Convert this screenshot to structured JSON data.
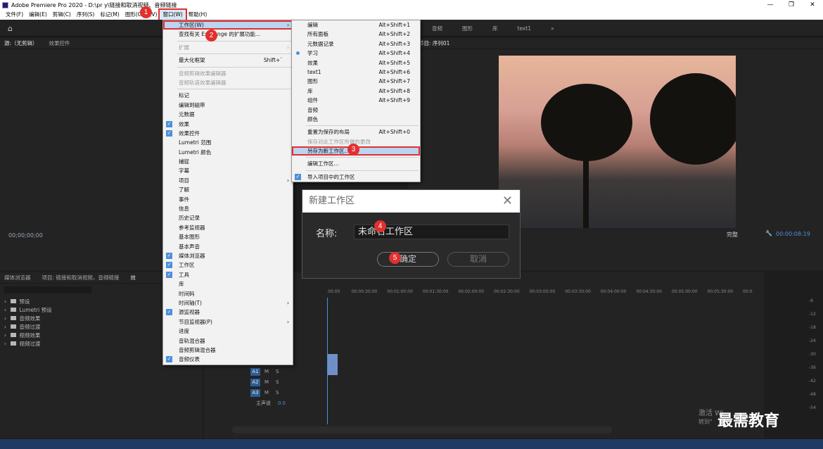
{
  "window": {
    "title": "Adobe Premiere Pro 2020 - D:\\pr y\\链接和取消视频、音频链接",
    "controls": [
      "—",
      "❐",
      "✕"
    ]
  },
  "menubar": [
    "文件(F)",
    "编辑(E)",
    "剪辑(C)",
    "序列(S)",
    "标记(M)",
    "图形(G)",
    "(V)",
    "窗口(W)",
    "帮助(H)"
  ],
  "workspace_tabs": [
    "音频",
    "图形",
    "库",
    "text1",
    "»"
  ],
  "source_panel": {
    "tabs": [
      "源:（无剪辑）",
      "效果控件"
    ],
    "timecode": "00;00;00;00"
  },
  "program_panel": {
    "title": "节目: 序列01",
    "fit": "完整",
    "timecode": "00:00:08:19"
  },
  "project_panel": {
    "tabs": [
      "媒体浏览器",
      "项目: 链接和取消视频，音频链接",
      "效"
    ],
    "tree": [
      "预设",
      "Lumetri 预设",
      "音频效果",
      "音频过渡",
      "视频效果",
      "视频过渡"
    ]
  },
  "window_menu": {
    "items": [
      {
        "label": "工作区(W)",
        "sub": true,
        "hl": true
      },
      {
        "label": "查找有关 Exchange 的扩展功能..."
      },
      {
        "sep": true
      },
      {
        "label": "扩展",
        "sub": true,
        "disabled": true
      },
      {
        "sep": true
      },
      {
        "label": "最大化框架",
        "shortcut": "Shift+`"
      },
      {
        "sep": true
      },
      {
        "label": "音频剪辑效果编辑器",
        "disabled": true
      },
      {
        "label": "音频轨道效果编辑器",
        "disabled": true
      },
      {
        "sep": true
      },
      {
        "label": "标记"
      },
      {
        "label": "编辑到磁带"
      },
      {
        "label": "元数据"
      },
      {
        "label": "效果",
        "checked": true
      },
      {
        "label": "效果控件",
        "checked": true
      },
      {
        "label": "Lumetri 范围"
      },
      {
        "label": "Lumetri 颜色"
      },
      {
        "label": "捕捉"
      },
      {
        "label": "字幕"
      },
      {
        "label": "项目",
        "sub": true
      },
      {
        "label": "了解"
      },
      {
        "label": "事件"
      },
      {
        "label": "信息"
      },
      {
        "label": "历史记录"
      },
      {
        "label": "参考监视器"
      },
      {
        "label": "基本图形"
      },
      {
        "label": "基本声音"
      },
      {
        "label": "媒体浏览器",
        "checked": true
      },
      {
        "label": "工作区",
        "checked": true
      },
      {
        "label": "工具",
        "checked": true
      },
      {
        "label": "库"
      },
      {
        "label": "时间码"
      },
      {
        "label": "时间轴(T)",
        "sub": true
      },
      {
        "label": "源监视器",
        "checked": true
      },
      {
        "label": "节目监视器(P)",
        "sub": true
      },
      {
        "label": "进度"
      },
      {
        "label": "音轨混合器"
      },
      {
        "label": "音频剪辑混合器"
      },
      {
        "label": "音频仪表",
        "checked": true
      }
    ]
  },
  "workspace_submenu": {
    "items": [
      {
        "label": "编辑",
        "shortcut": "Alt+Shift+1"
      },
      {
        "label": "所有面板",
        "shortcut": "Alt+Shift+2"
      },
      {
        "label": "元数据记录",
        "shortcut": "Alt+Shift+3"
      },
      {
        "label": "学习",
        "shortcut": "Alt+Shift+4",
        "dot": true
      },
      {
        "label": "效果",
        "shortcut": "Alt+Shift+5"
      },
      {
        "label": "text1",
        "shortcut": "Alt+Shift+6"
      },
      {
        "label": "图形",
        "shortcut": "Alt+Shift+7"
      },
      {
        "label": "库",
        "shortcut": "Alt+Shift+8"
      },
      {
        "label": "组件",
        "shortcut": "Alt+Shift+9"
      },
      {
        "label": "音频"
      },
      {
        "label": "颜色"
      },
      {
        "sep": true
      },
      {
        "label": "重置为保存的布局",
        "shortcut": "Alt+Shift+0"
      },
      {
        "label": "保存对此工作区所做的更改",
        "disabled": true
      },
      {
        "label": "另存为新工作区...",
        "hl": true
      },
      {
        "sep": true
      },
      {
        "label": "编辑工作区..."
      },
      {
        "sep": true
      },
      {
        "label": "导入项目中的工作区",
        "checked": true
      }
    ]
  },
  "dialog": {
    "title": "新建工作区",
    "close": "✕",
    "name_label": "名称:",
    "name_value": "未命名工作区",
    "ok": "确定",
    "cancel": "取消"
  },
  "badges": [
    "1",
    "2",
    "3",
    "4",
    "5"
  ],
  "timeline": {
    "ruler": [
      "00:00",
      "00:00:30:00",
      "00:01:00:00",
      "00:01:30:00",
      "00:02:00:00",
      "00:02:30:00",
      "00:03:00:00",
      "00:03:30:00",
      "00:04:00:00",
      "00:04:30:00",
      "00:05:00:00",
      "00:05:30:00",
      "00:0"
    ],
    "audio_tracks": [
      "A1",
      "A2",
      "A3"
    ],
    "track_buttons": [
      "M",
      "S"
    ],
    "master": "主声道",
    "master_value": "0.0"
  },
  "meter_ticks": [
    "-6",
    "-12",
    "-18",
    "-24",
    "-30",
    "-36",
    "-42",
    "-48",
    "-54"
  ],
  "watermark": {
    "activate": "激活 Wi",
    "activate2": "转到\"",
    "brand": "最需教育"
  }
}
